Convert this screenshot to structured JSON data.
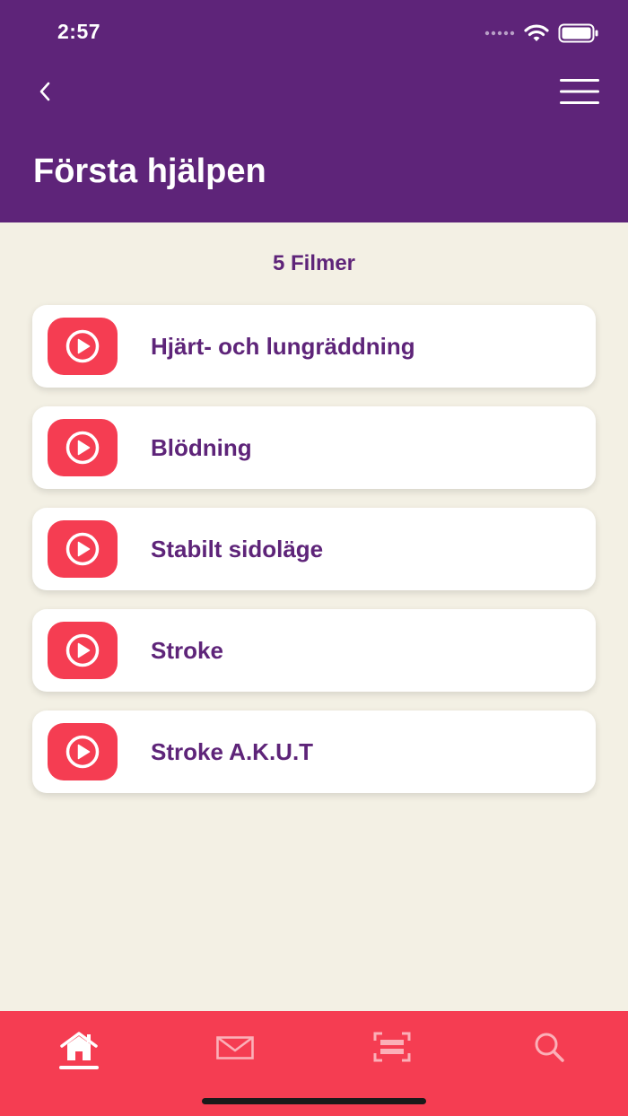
{
  "status_bar": {
    "time": "2:57",
    "icons": [
      "signal-dots-icon",
      "wifi-icon",
      "battery-icon"
    ]
  },
  "header": {
    "title": "Första hjälpen",
    "back_icon": "chevron-left-icon",
    "menu_icon": "hamburger-menu-icon",
    "background_color": "#5e2479"
  },
  "main": {
    "count_label": "5 Filmer",
    "videos": [
      {
        "label": "Hjärt- och lungräddning",
        "icon": "play-icon"
      },
      {
        "label": "Blödning",
        "icon": "play-icon"
      },
      {
        "label": "Stabilt sidoläge",
        "icon": "play-icon"
      },
      {
        "label": "Stroke",
        "icon": "play-icon"
      },
      {
        "label": "Stroke A.K.U.T",
        "icon": "play-icon"
      }
    ],
    "accent_color": "#f53d52"
  },
  "tab_bar": {
    "tabs": [
      {
        "name": "home",
        "icon": "home-icon",
        "active": true
      },
      {
        "name": "messages",
        "icon": "mail-icon",
        "active": false
      },
      {
        "name": "scan",
        "icon": "scan-icon",
        "active": false
      },
      {
        "name": "search",
        "icon": "search-icon",
        "active": false
      }
    ],
    "background_color": "#f53d52"
  }
}
